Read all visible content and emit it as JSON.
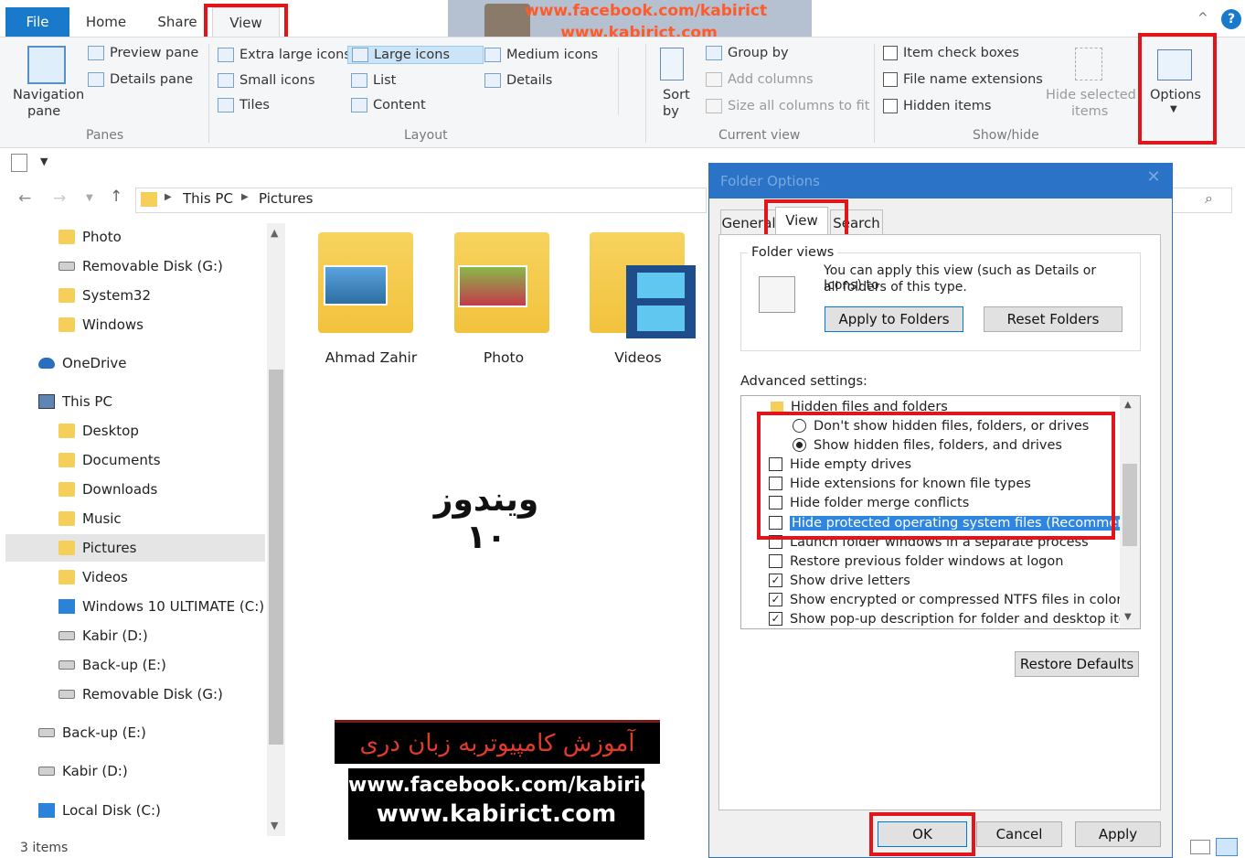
{
  "ribbon": {
    "tabs": [
      "File",
      "Home",
      "Share",
      "View"
    ],
    "panes": {
      "navigation_pane": "Navigation",
      "navigation_pane_2": "pane",
      "preview_pane": "Preview pane",
      "details_pane": "Details pane",
      "label": "Panes"
    },
    "layout": {
      "extra_large": "Extra large icons",
      "large": "Large icons",
      "medium": "Medium icons",
      "small": "Small icons",
      "list": "List",
      "details": "Details",
      "tiles": "Tiles",
      "content": "Content",
      "label": "Layout"
    },
    "current_view": {
      "sort_by": "Sort",
      "sort_by_2": "by",
      "group_by": "Group by",
      "add_columns": "Add columns",
      "size_columns": "Size all columns to fit",
      "label": "Current view"
    },
    "show_hide": {
      "item_check_boxes": "Item check boxes",
      "file_name_extensions": "File name extensions",
      "hidden_items": "Hidden items",
      "hide_selected": "Hide selected",
      "hide_selected_2": "items",
      "label": "Show/hide"
    },
    "options": "Options"
  },
  "address": {
    "this_pc": "This PC",
    "pictures": "Pictures"
  },
  "nav": {
    "items": [
      "Photo",
      "Removable Disk (G:)",
      "System32",
      "Windows",
      "OneDrive",
      "This PC",
      "Desktop",
      "Documents",
      "Downloads",
      "Music",
      "Pictures",
      "Videos",
      "Windows 10 ULTIMATE (C:)",
      "Kabir (D:)",
      "Back-up (E:)",
      "Removable Disk (G:)",
      "Back-up (E:)",
      "Kabir (D:)",
      "Local Disk (C:)"
    ]
  },
  "content": {
    "folders": [
      "Ahmad Zahir",
      "Photo",
      "Videos"
    ],
    "overlay_text": "ویندوز ۱۰"
  },
  "status": {
    "items": "3 items"
  },
  "dialog": {
    "title": "Folder Options",
    "tabs": [
      "General",
      "View",
      "Search"
    ],
    "folder_views": "Folder views",
    "folder_views_text": "You can apply this view (such as Details or Icons) to",
    "folder_views_text_2": "all folders of this type.",
    "apply_to_folders": "Apply to Folders",
    "reset_folders": "Reset Folders",
    "advanced_settings": "Advanced settings:",
    "settings": {
      "hidden_files_header": "Hidden files and folders",
      "dont_show": "Don't show hidden files, folders, or drives",
      "show_hidden": "Show hidden files, folders, and drives",
      "hide_empty": "Hide empty drives",
      "hide_extensions": "Hide extensions for known file types",
      "hide_merge": "Hide folder merge conflicts",
      "hide_protected": "Hide protected operating system files (Recommended)",
      "launch_separate": "Launch folder windows in a separate process",
      "restore_previous": "Restore previous folder windows at logon",
      "show_drive_letters": "Show drive letters",
      "show_encrypted": "Show encrypted or compressed NTFS files in color",
      "show_popup": "Show pop-up description for folder and desktop items"
    },
    "restore_defaults": "Restore Defaults",
    "ok": "OK",
    "cancel": "Cancel",
    "apply": "Apply"
  },
  "banners": {
    "persian": "آموزش کامپیوتربه زبان دری",
    "facebook": "www.facebook.com/kabirict",
    "website": "www.kabirict.com"
  },
  "watermark": {
    "line1": "www.facebook.com/kabirict",
    "line2": "www.kabirict.com"
  }
}
